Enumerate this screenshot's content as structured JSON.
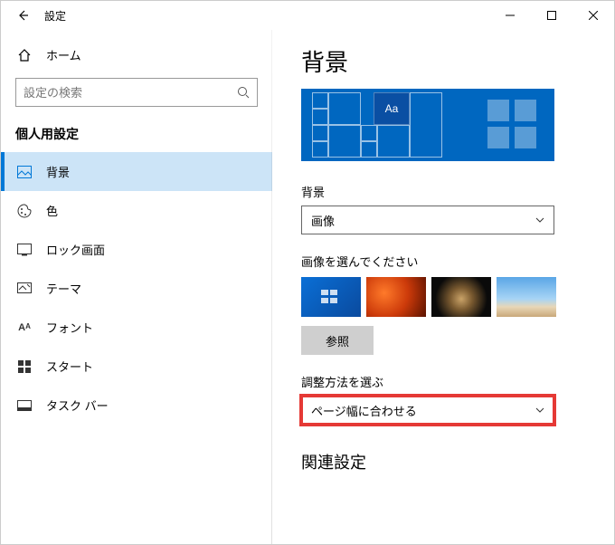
{
  "window": {
    "title": "設定"
  },
  "sidebar": {
    "home": "ホーム",
    "search_placeholder": "設定の検索",
    "section": "個人用設定",
    "items": [
      {
        "label": "背景"
      },
      {
        "label": "色"
      },
      {
        "label": "ロック画面"
      },
      {
        "label": "テーマ"
      },
      {
        "label": "フォント"
      },
      {
        "label": "スタート"
      },
      {
        "label": "タスク バー"
      }
    ]
  },
  "content": {
    "title": "背景",
    "preview_sample": "Aa",
    "bg_label": "背景",
    "bg_value": "画像",
    "choose_label": "画像を選んでください",
    "browse": "参照",
    "fit_label": "調整方法を選ぶ",
    "fit_value": "ページ幅に合わせる",
    "related_cutoff": "関連設定"
  }
}
